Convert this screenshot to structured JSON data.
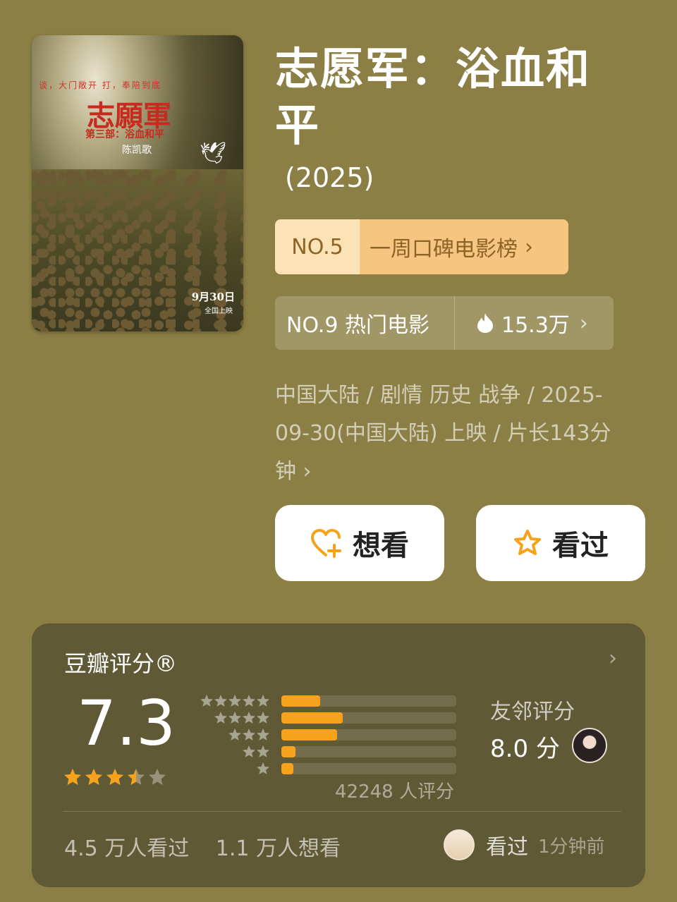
{
  "poster": {
    "tagline": "谈，大门敞开 打，奉陪到底",
    "title": "志願軍",
    "subtitle": "第三部：浴血和平",
    "director": "陈凯歌",
    "date": "9月30日",
    "date_sub": "全国上映"
  },
  "movie": {
    "title": "志愿军：浴血和平",
    "year": "(2025)"
  },
  "ranks": {
    "primary": {
      "no": "NO.5",
      "label": "一周口碑电影榜"
    },
    "secondary": {
      "label": "NO.9 热门电影",
      "heat": "15.3万"
    }
  },
  "meta": "中国大陆 / 剧情 历史 战争 / 2025-09-30(中国大陆) 上映 / 片长143分钟",
  "actions": {
    "want": "想看",
    "seen": "看过"
  },
  "rating": {
    "title": "豆瓣评分®",
    "score": "7.3",
    "stars": 3.5,
    "distribution": [
      {
        "stars": 5,
        "fraction": 0.22
      },
      {
        "stars": 4,
        "fraction": 0.35
      },
      {
        "stars": 3,
        "fraction": 0.32
      },
      {
        "stars": 2,
        "fraction": 0.08
      },
      {
        "stars": 1,
        "fraction": 0.07
      }
    ],
    "count": "42248 人评分",
    "friend_label": "友邻评分",
    "friend_score": "8.0 分",
    "seen_count": "4.5 万人看过",
    "want_count": "1.1 万人想看",
    "recent_action": "看过",
    "recent_time": "1分钟前"
  },
  "colors": {
    "background": "#8c7f45",
    "card": "#605935",
    "accent": "#f7a21b"
  }
}
